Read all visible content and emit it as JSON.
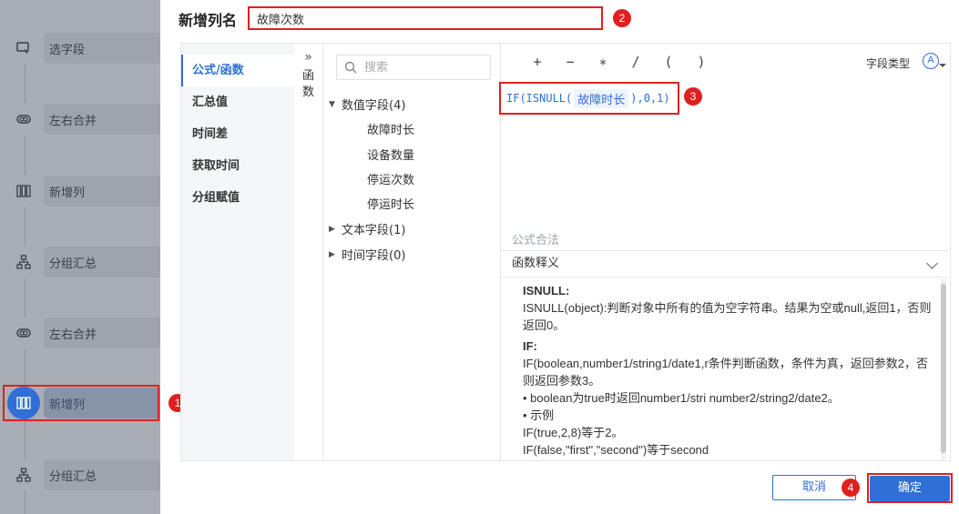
{
  "flow": {
    "items": [
      {
        "label": "选字段",
        "icon": "select-field-icon"
      },
      {
        "label": "左右合并",
        "icon": "merge-icon"
      },
      {
        "label": "新增列",
        "icon": "add-column-icon"
      },
      {
        "label": "分组汇总",
        "icon": "group-summary-icon"
      },
      {
        "label": "左右合并",
        "icon": "merge-icon"
      },
      {
        "label": "新增列",
        "icon": "add-column-icon",
        "active": true
      },
      {
        "label": "分组汇总",
        "icon": "group-summary-icon"
      }
    ]
  },
  "dialog": {
    "title": "新增列名",
    "column_name": "故障次数"
  },
  "menu": {
    "items": [
      "公式/函数",
      "汇总值",
      "时间差",
      "获取时间",
      "分组赋值"
    ]
  },
  "function_toggle": {
    "arrows": "»",
    "label_line1": "函",
    "label_line2": "数"
  },
  "tree": {
    "search_placeholder": "搜索",
    "groups": [
      {
        "label": "数值字段(4)",
        "expanded": true,
        "children": [
          "故障时长",
          "设备数量",
          "停运次数",
          "停运时长"
        ]
      },
      {
        "label": "文本字段(1)",
        "expanded": false
      },
      {
        "label": "时间字段(0)",
        "expanded": false
      }
    ]
  },
  "editor": {
    "operators": [
      "+",
      "−",
      "∗",
      "/",
      "(",
      ")"
    ],
    "field_type_label": "字段类型",
    "field_type_icon": "A",
    "formula_prefix": "IF(ISNULL(",
    "formula_field": "故障时长",
    "formula_suffix": "),0,1)",
    "legal_text": "公式合法",
    "explain_title": "函数释义",
    "explain_lines": [
      {
        "text": "ISNULL:",
        "bold": true
      },
      {
        "text": "ISNULL(object):判断对象中所有的值为空字符串。结果为空或null,返回1，否则返回0。",
        "bold": false
      },
      {
        "text": "IF:",
        "bold": true
      },
      {
        "text": "IF(boolean,number1/string1/date1,r条件判断函数，条件为真，返回参数2，否则返回参数3。",
        "bold": false
      },
      {
        "text": "• boolean为true时返回number1/stri number2/string2/date2。",
        "bold": false
      },
      {
        "text": "• 示例",
        "bold": false
      },
      {
        "text": "IF(true,2,8)等于2。",
        "bold": false
      },
      {
        "text": "IF(false,\"first\",\"second\")等于second",
        "bold": false
      }
    ]
  },
  "buttons": {
    "cancel": "取消",
    "ok": "确定"
  },
  "badges": [
    "1",
    "2",
    "3",
    "4"
  ],
  "colors": {
    "accent": "#2f6fd6",
    "highlight": "#e02020"
  }
}
